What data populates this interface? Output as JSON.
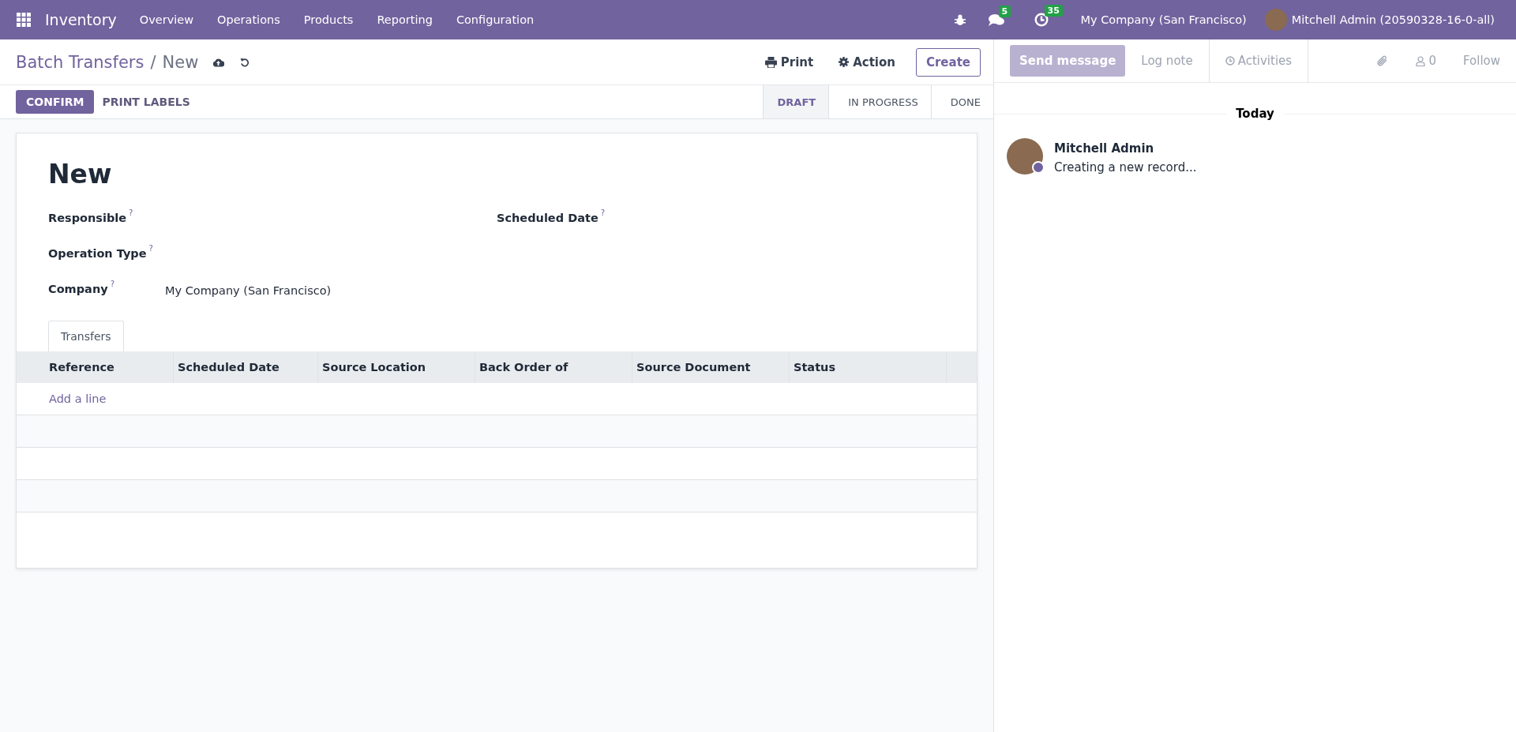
{
  "navbar": {
    "app_name": "Inventory",
    "menu": [
      "Overview",
      "Operations",
      "Products",
      "Reporting",
      "Configuration"
    ],
    "messages_count": "5",
    "activities_count": "35",
    "company": "My Company (San Francisco)",
    "user": "Mitchell Admin (20590328-16-0-all)"
  },
  "breadcrumb": {
    "parent": "Batch Transfers",
    "separator": "/",
    "current": "New"
  },
  "actions": {
    "print": "Print",
    "action": "Action",
    "create": "Create"
  },
  "buttons": {
    "confirm": "CONFIRM",
    "print_labels": "PRINT LABELS"
  },
  "statusbar": [
    {
      "label": "DRAFT",
      "selected": true
    },
    {
      "label": "IN PROGRESS",
      "selected": false
    },
    {
      "label": "DONE",
      "selected": false
    }
  ],
  "form": {
    "title": "New",
    "help_mark": "?",
    "left_fields": [
      {
        "label": "Responsible"
      },
      {
        "label": "Operation Type"
      },
      {
        "label": "Company",
        "value": "My Company (San Francisco)"
      }
    ],
    "right_fields": [
      {
        "label": "Scheduled Date"
      }
    ],
    "tabs": [
      {
        "label": "Transfers",
        "selected": true
      }
    ],
    "table": {
      "columns": [
        "Reference",
        "Scheduled Date",
        "Source Location",
        "Back Order of",
        "Source Document",
        "Status"
      ],
      "add_line": "Add a line"
    }
  },
  "chatter": {
    "send_message": "Send message",
    "log_note": "Log note",
    "activities": "Activities",
    "followers_count": "0",
    "follow": "Follow",
    "date_separator": "Today",
    "messages": [
      {
        "author": "Mitchell Admin",
        "body": "Creating a new record..."
      }
    ]
  }
}
